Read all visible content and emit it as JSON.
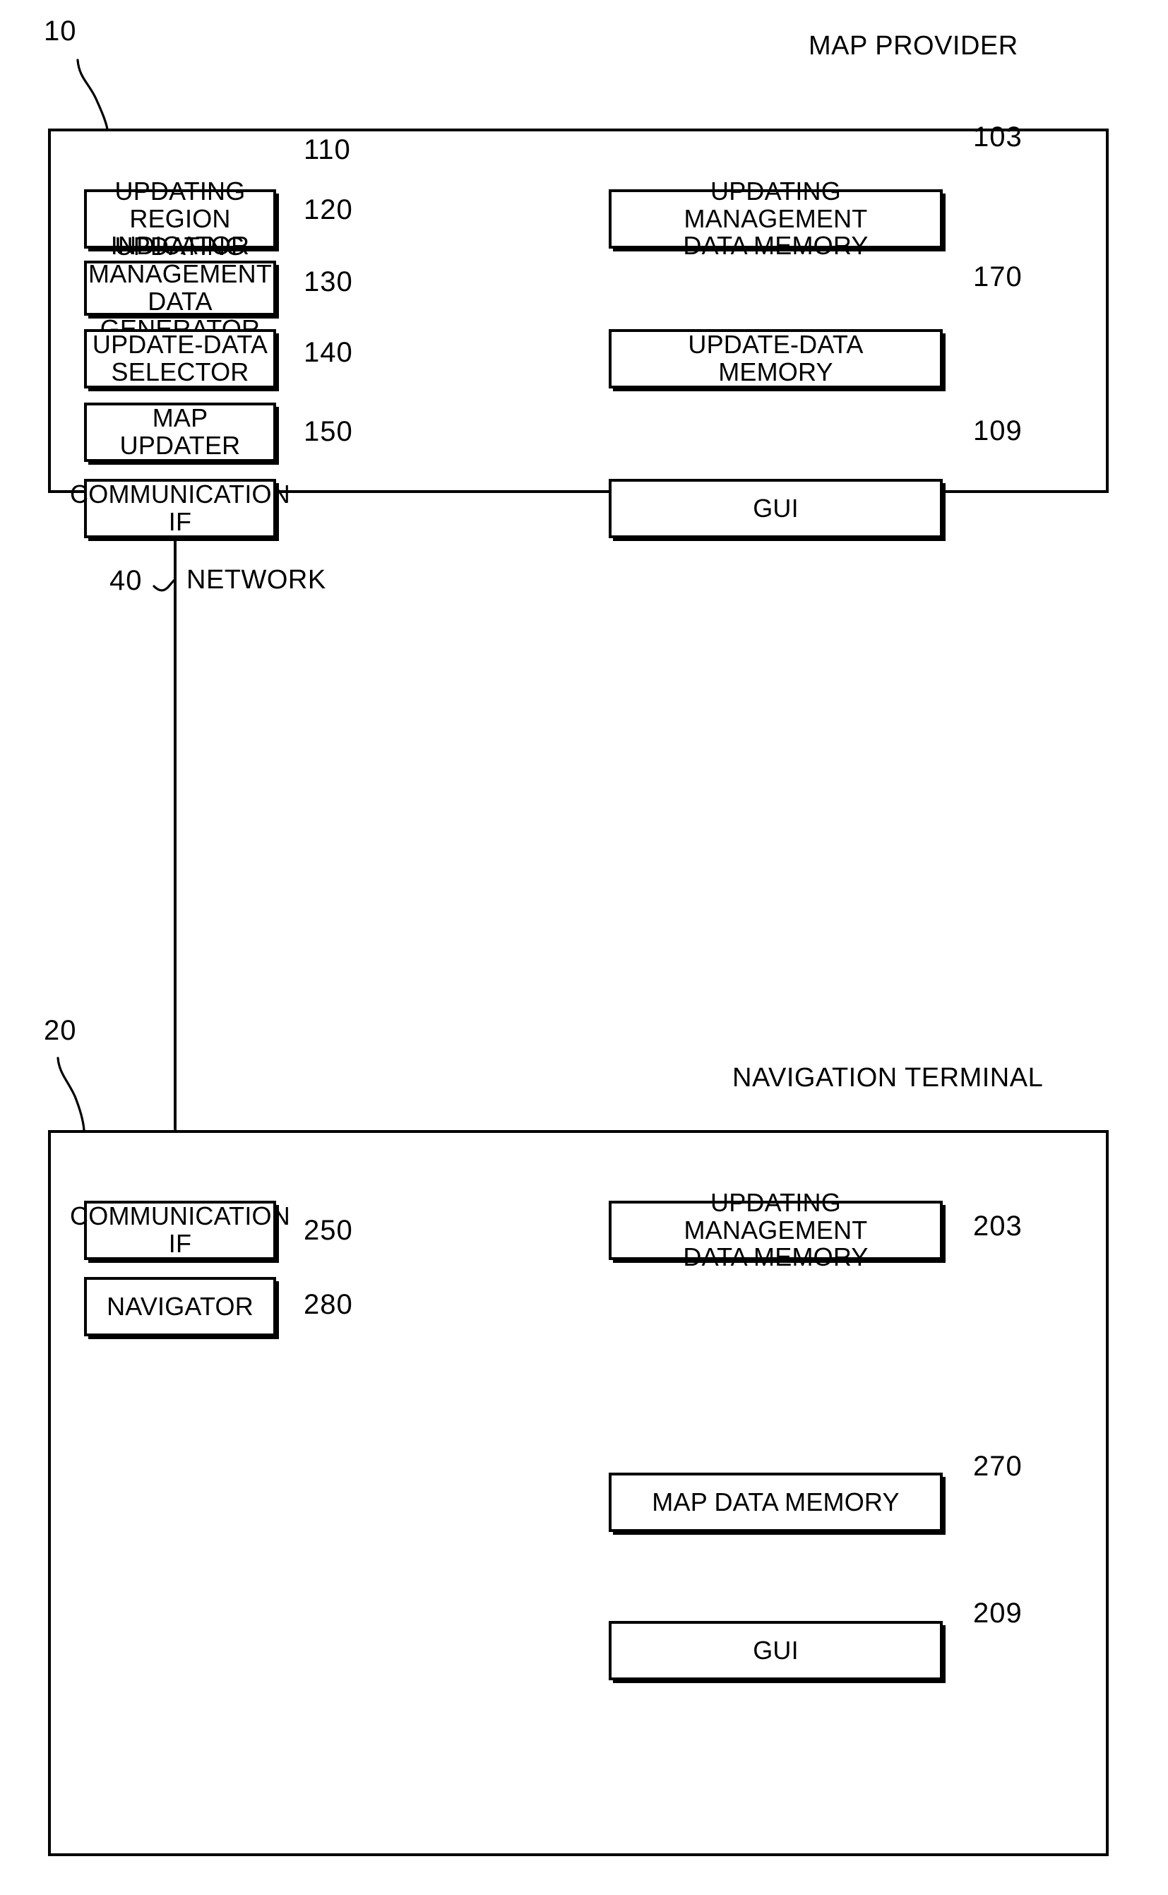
{
  "figure": {
    "type": "patent-block-diagram",
    "background": "#ffffff",
    "line_color": "#000000"
  },
  "map_provider": {
    "ref": "10",
    "title": "MAP PROVIDER",
    "left_column": [
      {
        "ref": "110",
        "label": "UPDATING REGION\nINDICATOR"
      },
      {
        "ref": "120",
        "label": "UPDATING MANAGEMENT\nDATA GENERATOR"
      },
      {
        "ref": "130",
        "label": "UPDATE-DATA\nSELECTOR"
      },
      {
        "ref": "140",
        "label": "MAP UPDATER"
      },
      {
        "ref": "150",
        "label": "COMMUNICATION IF"
      }
    ],
    "right_column": [
      {
        "ref": "103",
        "label": "UPDATING MANAGEMENT\nDATA MEMORY"
      },
      {
        "ref": "170",
        "label": "UPDATE-DATA\nMEMORY"
      },
      {
        "ref": "109",
        "label": "GUI"
      }
    ]
  },
  "network": {
    "ref": "40",
    "label": "NETWORK"
  },
  "navigation_terminal": {
    "ref": "20",
    "title": "NAVIGATION TERMINAL",
    "left_column": [
      {
        "ref": "250",
        "label": "COMMUNICATION IF"
      },
      {
        "ref": "280",
        "label": "NAVIGATOR"
      }
    ],
    "right_column": [
      {
        "ref": "203",
        "label": "UPDATING MANAGEMENT\nDATA MEMORY"
      },
      {
        "ref": "270",
        "label": "MAP DATA MEMORY"
      },
      {
        "ref": "209",
        "label": "GUI"
      }
    ]
  }
}
